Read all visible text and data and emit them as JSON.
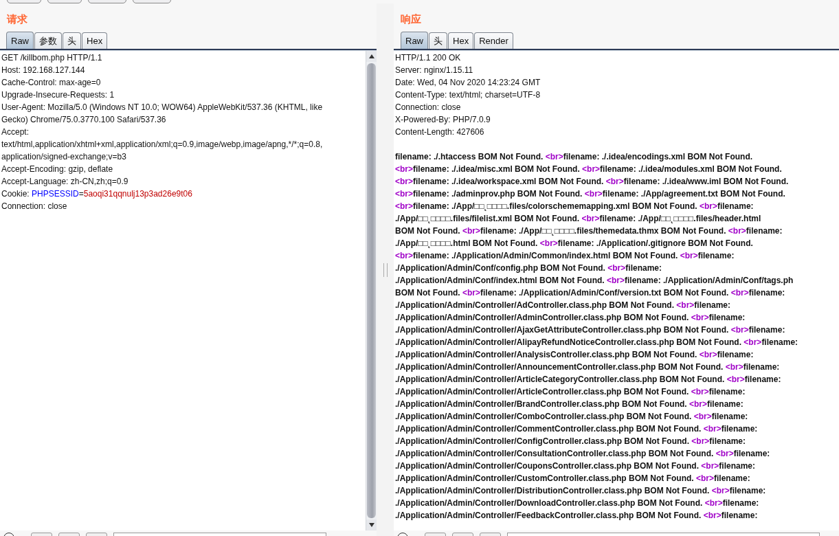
{
  "request": {
    "title": "请求",
    "tabs": [
      {
        "label": "Raw",
        "selected": true
      },
      {
        "label": "参数",
        "selected": false
      },
      {
        "label": "头",
        "selected": false
      },
      {
        "label": "Hex",
        "selected": false
      }
    ],
    "lines": [
      [
        {
          "kind": "text",
          "text": "GET /killbom.php HTTP/1.1"
        }
      ],
      [
        {
          "kind": "text",
          "text": "Host: 192.168.127.144"
        }
      ],
      [
        {
          "kind": "text",
          "text": "Cache-Control: max-age=0"
        }
      ],
      [
        {
          "kind": "text",
          "text": "Upgrade-Insecure-Requests: 1"
        }
      ],
      [
        {
          "kind": "text",
          "text": "User-Agent: Mozilla/5.0 (Windows NT 10.0; WOW64) AppleWebKit/537.36 (KHTML, like"
        }
      ],
      [
        {
          "kind": "text",
          "text": "Gecko) Chrome/75.0.3770.100 Safari/537.36"
        }
      ],
      [
        {
          "kind": "text",
          "text": "Accept:"
        }
      ],
      [
        {
          "kind": "text",
          "text": "text/html,application/xhtml+xml,application/xml;q=0.9,image/webp,image/apng,*/*;q=0.8,"
        }
      ],
      [
        {
          "kind": "text",
          "text": "application/signed-exchange;v=b3"
        }
      ],
      [
        {
          "kind": "text",
          "text": "Accept-Encoding: gzip, deflate"
        }
      ],
      [
        {
          "kind": "text",
          "text": "Accept-Language: zh-CN,zh;q=0.9"
        }
      ],
      [
        {
          "kind": "text",
          "text": "Cookie: "
        },
        {
          "kind": "name",
          "text": "PHPSESSID"
        },
        {
          "kind": "text",
          "text": "="
        },
        {
          "kind": "value",
          "text": "5aoqi31qqnulj13p3ad26e9t06"
        }
      ],
      [
        {
          "kind": "text",
          "text": "Connection: close"
        }
      ]
    ]
  },
  "response": {
    "title": "响应",
    "tabs": [
      {
        "label": "Raw",
        "selected": true
      },
      {
        "label": "头",
        "selected": false
      },
      {
        "label": "Hex",
        "selected": false
      },
      {
        "label": "Render",
        "selected": false
      }
    ],
    "headers": [
      "HTTP/1.1 200 OK",
      "Server: nginx/1.15.11",
      "Date: Wed, 04 Nov 2020 14:23:24 GMT",
      "Content-Type: text/html; charset=UTF-8",
      "Connection: close",
      "X-Powered-By: PHP/7.0.9",
      "Content-Length: 427606"
    ],
    "body": [
      [
        {
          "kind": "text",
          "text": "filename: ./.htaccess BOM Not Found. "
        },
        {
          "kind": "tag",
          "text": "<br>"
        },
        {
          "kind": "text",
          "text": "filename: ./.idea/encodings.xml BOM Not Found."
        }
      ],
      [
        {
          "kind": "tag",
          "text": "<br>"
        },
        {
          "kind": "text",
          "text": "filename: ./.idea/misc.xml BOM Not Found. "
        },
        {
          "kind": "tag",
          "text": "<br>"
        },
        {
          "kind": "text",
          "text": "filename: ./.idea/modules.xml BOM Not Found."
        }
      ],
      [
        {
          "kind": "tag",
          "text": "<br>"
        },
        {
          "kind": "text",
          "text": "filename: ./.idea/workspace.xml BOM Not Found. "
        },
        {
          "kind": "tag",
          "text": "<br>"
        },
        {
          "kind": "text",
          "text": "filename: ./.idea/www.iml BOM Not Found."
        }
      ],
      [
        {
          "kind": "tag",
          "text": "<br>"
        },
        {
          "kind": "text",
          "text": "filename: ./adminprov.php BOM Not Found. "
        },
        {
          "kind": "tag",
          "text": "<br>"
        },
        {
          "kind": "text",
          "text": "filename: ./App/agreement.txt BOM Not Found."
        }
      ],
      [
        {
          "kind": "tag",
          "text": "<br>"
        },
        {
          "kind": "text",
          "text": "filename: ./App/□□˛□□□□.files/colorschememapping.xml BOM Not Found. "
        },
        {
          "kind": "tag",
          "text": "<br>"
        },
        {
          "kind": "text",
          "text": "filename:"
        }
      ],
      [
        {
          "kind": "text",
          "text": "./App/□□˛□□□□.files/filelist.xml BOM Not Found. "
        },
        {
          "kind": "tag",
          "text": "<br>"
        },
        {
          "kind": "text",
          "text": "filename: ./App/□□˛□□□□.files/header.html"
        }
      ],
      [
        {
          "kind": "text",
          "text": "BOM Not Found. "
        },
        {
          "kind": "tag",
          "text": "<br>"
        },
        {
          "kind": "text",
          "text": "filename: ./App/□□˛□□□□.files/themedata.thmx BOM Not Found. "
        },
        {
          "kind": "tag",
          "text": "<br>"
        },
        {
          "kind": "text",
          "text": "filename:"
        }
      ],
      [
        {
          "kind": "text",
          "text": "./App/□□˛□□□□.html BOM Not Found. "
        },
        {
          "kind": "tag",
          "text": "<br>"
        },
        {
          "kind": "text",
          "text": "filename: ./Application/.gitignore BOM Not Found."
        }
      ],
      [
        {
          "kind": "tag",
          "text": "<br>"
        },
        {
          "kind": "text",
          "text": "filename: ./Application/Admin/Common/index.html BOM Not Found. "
        },
        {
          "kind": "tag",
          "text": "<br>"
        },
        {
          "kind": "text",
          "text": "filename:"
        }
      ],
      [
        {
          "kind": "text",
          "text": "./Application/Admin/Conf/config.php BOM Not Found. "
        },
        {
          "kind": "tag",
          "text": "<br>"
        },
        {
          "kind": "text",
          "text": "filename:"
        }
      ],
      [
        {
          "kind": "text",
          "text": "./Application/Admin/Conf/index.html BOM Not Found. "
        },
        {
          "kind": "tag",
          "text": "<br>"
        },
        {
          "kind": "text",
          "text": "filename: ./Application/Admin/Conf/tags.ph"
        }
      ],
      [
        {
          "kind": "text",
          "text": "BOM Not Found. "
        },
        {
          "kind": "tag",
          "text": "<br>"
        },
        {
          "kind": "text",
          "text": "filename: ./Application/Admin/Conf/version.txt BOM Not Found. "
        },
        {
          "kind": "tag",
          "text": "<br>"
        },
        {
          "kind": "text",
          "text": "filename:"
        }
      ],
      [
        {
          "kind": "text",
          "text": "./Application/Admin/Controller/AdController.class.php BOM Not Found. "
        },
        {
          "kind": "tag",
          "text": "<br>"
        },
        {
          "kind": "text",
          "text": "filename:"
        }
      ],
      [
        {
          "kind": "text",
          "text": "./Application/Admin/Controller/AdminController.class.php BOM Not Found. "
        },
        {
          "kind": "tag",
          "text": "<br>"
        },
        {
          "kind": "text",
          "text": "filename:"
        }
      ],
      [
        {
          "kind": "text",
          "text": "./Application/Admin/Controller/AjaxGetAttributeController.class.php BOM Not Found. "
        },
        {
          "kind": "tag",
          "text": "<br>"
        },
        {
          "kind": "text",
          "text": "filename:"
        }
      ],
      [
        {
          "kind": "text",
          "text": "./Application/Admin/Controller/AlipayRefundNoticeController.class.php BOM Not Found. "
        },
        {
          "kind": "tag",
          "text": "<br>"
        },
        {
          "kind": "text",
          "text": "filename:"
        }
      ],
      [
        {
          "kind": "text",
          "text": "./Application/Admin/Controller/AnalysisController.class.php BOM Not Found. "
        },
        {
          "kind": "tag",
          "text": "<br>"
        },
        {
          "kind": "text",
          "text": "filename:"
        }
      ],
      [
        {
          "kind": "text",
          "text": "./Application/Admin/Controller/AnnouncementController.class.php BOM Not Found. "
        },
        {
          "kind": "tag",
          "text": "<br>"
        },
        {
          "kind": "text",
          "text": "filename:"
        }
      ],
      [
        {
          "kind": "text",
          "text": "./Application/Admin/Controller/ArticleCategoryController.class.php BOM Not Found. "
        },
        {
          "kind": "tag",
          "text": "<br>"
        },
        {
          "kind": "text",
          "text": "filename:"
        }
      ],
      [
        {
          "kind": "text",
          "text": "./Application/Admin/Controller/ArticleController.class.php BOM Not Found. "
        },
        {
          "kind": "tag",
          "text": "<br>"
        },
        {
          "kind": "text",
          "text": "filename:"
        }
      ],
      [
        {
          "kind": "text",
          "text": "./Application/Admin/Controller/BrandController.class.php BOM Not Found. "
        },
        {
          "kind": "tag",
          "text": "<br>"
        },
        {
          "kind": "text",
          "text": "filename:"
        }
      ],
      [
        {
          "kind": "text",
          "text": "./Application/Admin/Controller/ComboController.class.php BOM Not Found. "
        },
        {
          "kind": "tag",
          "text": "<br>"
        },
        {
          "kind": "text",
          "text": "filename:"
        }
      ],
      [
        {
          "kind": "text",
          "text": "./Application/Admin/Controller/CommentController.class.php BOM Not Found. "
        },
        {
          "kind": "tag",
          "text": "<br>"
        },
        {
          "kind": "text",
          "text": "filename:"
        }
      ],
      [
        {
          "kind": "text",
          "text": "./Application/Admin/Controller/ConfigController.class.php BOM Not Found. "
        },
        {
          "kind": "tag",
          "text": "<br>"
        },
        {
          "kind": "text",
          "text": "filename:"
        }
      ],
      [
        {
          "kind": "text",
          "text": "./Application/Admin/Controller/ConsultationController.class.php BOM Not Found. "
        },
        {
          "kind": "tag",
          "text": "<br>"
        },
        {
          "kind": "text",
          "text": "filename:"
        }
      ],
      [
        {
          "kind": "text",
          "text": "./Application/Admin/Controller/CouponsController.class.php BOM Not Found. "
        },
        {
          "kind": "tag",
          "text": "<br>"
        },
        {
          "kind": "text",
          "text": "filename:"
        }
      ],
      [
        {
          "kind": "text",
          "text": "./Application/Admin/Controller/CustomController.class.php BOM Not Found. "
        },
        {
          "kind": "tag",
          "text": "<br>"
        },
        {
          "kind": "text",
          "text": "filename:"
        }
      ],
      [
        {
          "kind": "text",
          "text": "./Application/Admin/Controller/DistributionController.class.php BOM Not Found. "
        },
        {
          "kind": "tag",
          "text": "<br>"
        },
        {
          "kind": "text",
          "text": "filename:"
        }
      ],
      [
        {
          "kind": "text",
          "text": "./Application/Admin/Controller/DownloadController.class.php BOM Not Found. "
        },
        {
          "kind": "tag",
          "text": "<br>"
        },
        {
          "kind": "text",
          "text": "filename:"
        }
      ],
      [
        {
          "kind": "text",
          "text": "./Application/Admin/Controller/FeedbackController.class.php BOM Not Found. "
        },
        {
          "kind": "tag",
          "text": "<br>"
        },
        {
          "kind": "text",
          "text": "filename:"
        }
      ]
    ]
  }
}
